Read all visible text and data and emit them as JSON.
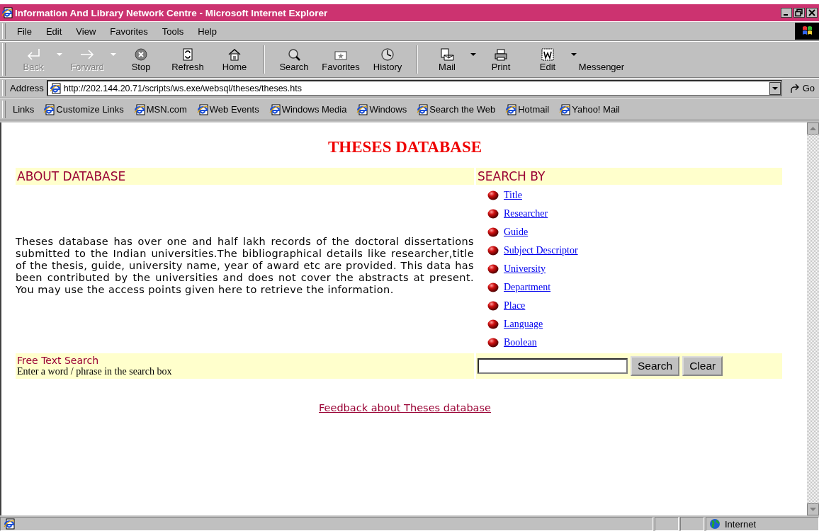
{
  "window": {
    "title": "Information And Library Network Centre - Microsoft Internet Explorer"
  },
  "menu": [
    "File",
    "Edit",
    "View",
    "Favorites",
    "Tools",
    "Help"
  ],
  "toolbar": [
    {
      "label": "Back",
      "disabled": true,
      "dropdown": true
    },
    {
      "label": "Forward",
      "disabled": true,
      "dropdown": true
    },
    {
      "label": "Stop",
      "disabled": false,
      "dropdown": false
    },
    {
      "label": "Refresh",
      "disabled": false,
      "dropdown": false
    },
    {
      "label": "Home",
      "disabled": false,
      "dropdown": false
    },
    {
      "label": "Search",
      "disabled": false,
      "dropdown": false
    },
    {
      "label": "Favorites",
      "disabled": false,
      "dropdown": false
    },
    {
      "label": "History",
      "disabled": false,
      "dropdown": false
    },
    {
      "label": "Mail",
      "disabled": false,
      "dropdown": true
    },
    {
      "label": "Print",
      "disabled": false,
      "dropdown": false
    },
    {
      "label": "Edit",
      "disabled": false,
      "dropdown": true
    },
    {
      "label": "Messenger",
      "disabled": false,
      "dropdown": false
    }
  ],
  "address_bar": {
    "label": "Address",
    "url": "http://202.144.20.71/scripts/ws.exe/websql/theses/theses.hts",
    "go": "Go"
  },
  "links_bar": {
    "label": "Links",
    "links": [
      "Customize Links",
      "MSN.com",
      "Web Events",
      "Windows Media",
      "Windows",
      "Search the Web",
      "Hotmail",
      "Yahoo! Mail"
    ]
  },
  "page": {
    "heading": "THESES DATABASE",
    "about_heading": "ABOUT DATABASE",
    "about_text": "Theses database has over one and half lakh records of the doctoral dissertations submitted to the Indian universities.The bibliographical details like researcher,title of the thesis, guide, university name, year of award etc are provided. This data has been contributed by the universities and does not cover the abstracts at present. You may use the access points given here to retrieve the information.",
    "search_heading": "SEARCH BY",
    "search_options": [
      "Title",
      "Researcher",
      "Guide",
      "Subject Descriptor",
      "University",
      "Department",
      "Place",
      "Language",
      "Boolean"
    ],
    "free_text_label": "Free Text Search",
    "free_text_hint": "Enter a word / phrase in the search box",
    "buttons": [
      "Search",
      "Clear"
    ],
    "feedback_link": "Feedback about Theses database"
  },
  "status_bar": {
    "zone": "Internet"
  }
}
